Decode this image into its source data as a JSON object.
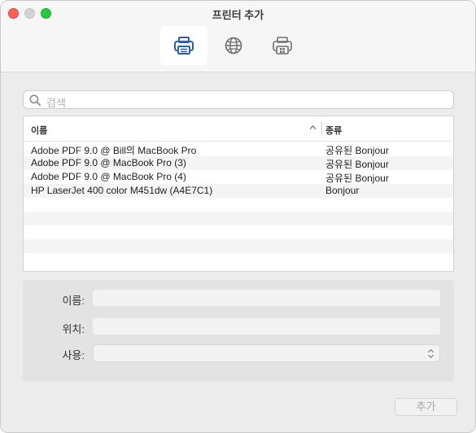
{
  "window": {
    "title": "프린터 추가"
  },
  "toolbar": {
    "tabs": [
      {
        "icon": "printer-icon",
        "selected": true
      },
      {
        "icon": "globe-icon",
        "selected": false
      },
      {
        "icon": "windows-printer-icon",
        "selected": false
      }
    ]
  },
  "search": {
    "placeholder": "검색"
  },
  "table": {
    "columns": {
      "name": "이름",
      "kind": "종류"
    },
    "sort": "ascending",
    "rows": [
      {
        "name": "Adobe PDF 9.0 @ Bill의 MacBook Pro",
        "kind": "공유된 Bonjour"
      },
      {
        "name": "Adobe PDF 9.0 @ MacBook Pro (3)",
        "kind": "공유된 Bonjour"
      },
      {
        "name": "Adobe PDF 9.0 @ MacBook Pro (4)",
        "kind": "공유된 Bonjour"
      },
      {
        "name": "HP LaserJet 400 color M451dw (A4E7C1)",
        "kind": "Bonjour"
      }
    ]
  },
  "details": {
    "name_label": "이름:",
    "location_label": "위치:",
    "use_label": "사용:",
    "name_value": "",
    "location_value": "",
    "use_value": ""
  },
  "footer": {
    "add_label": "추가"
  },
  "colors": {
    "close": "#fe5f57",
    "minimize": "#d4d4d4",
    "maximize": "#28c840",
    "accent": "#2d5fa6"
  }
}
